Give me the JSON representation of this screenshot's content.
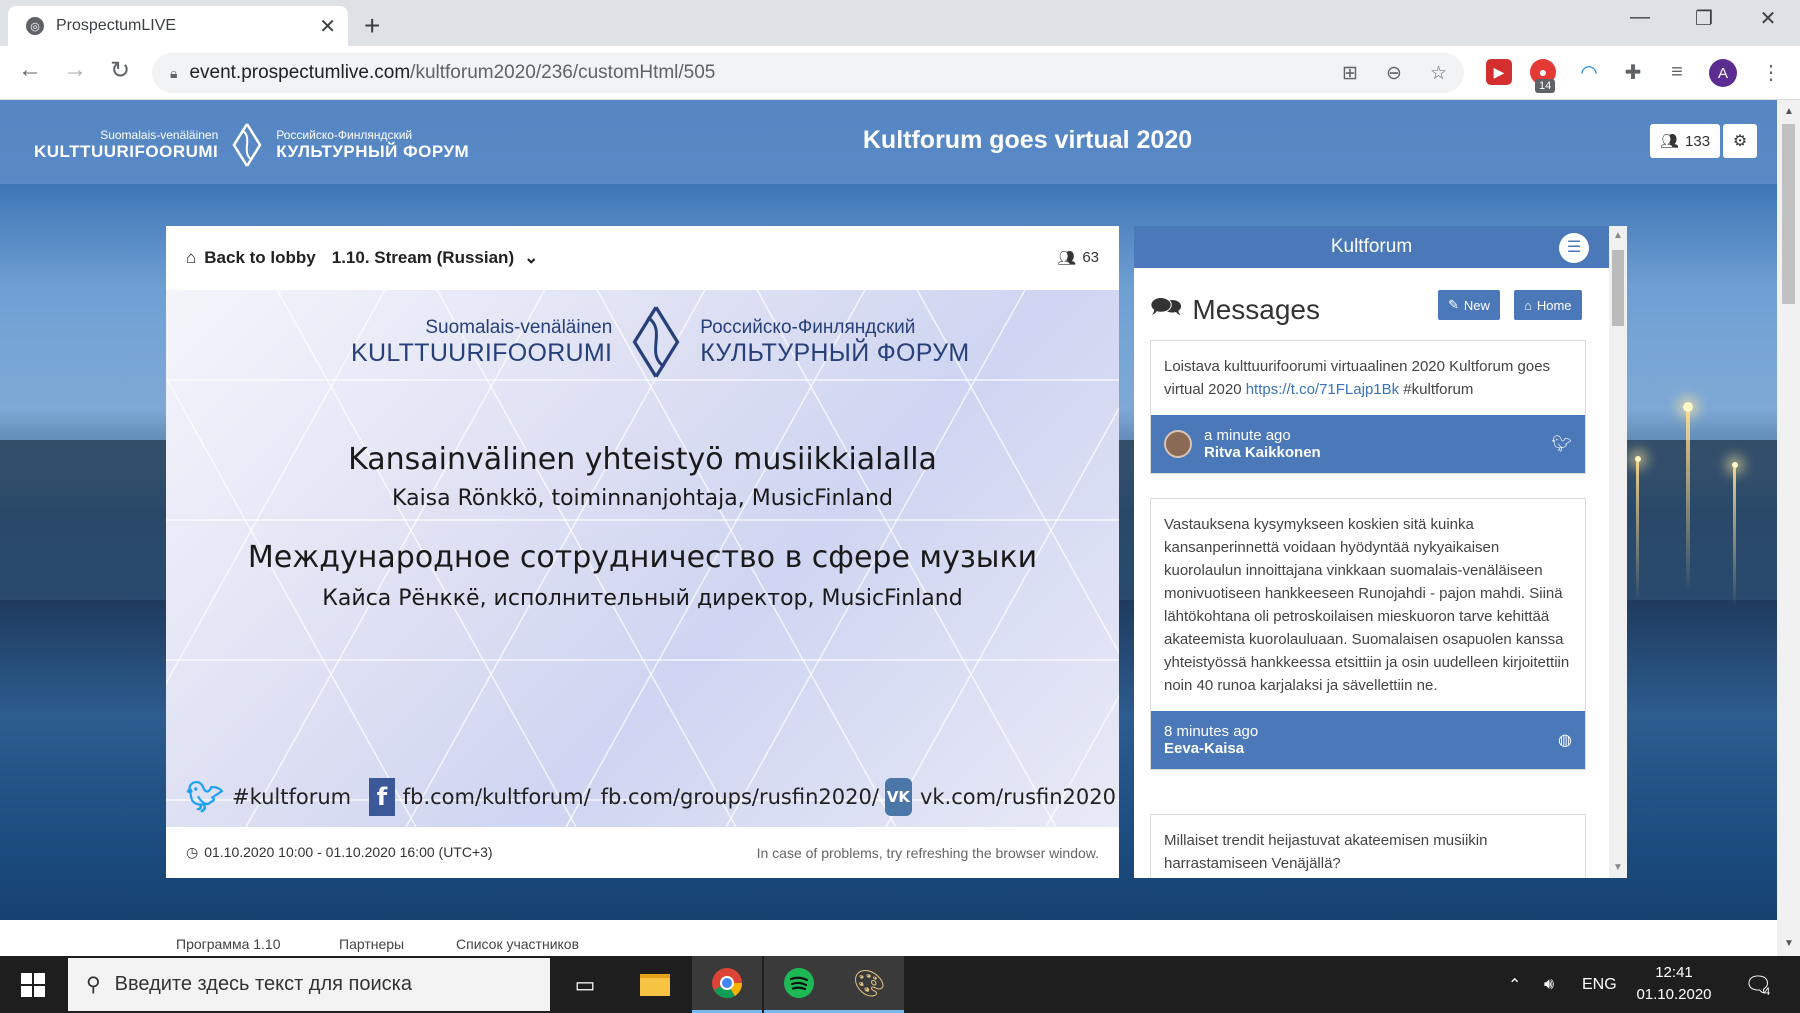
{
  "browser": {
    "tab_title": "ProspectumLIVE",
    "url_domain": "event.prospectumlive.com",
    "url_path": "/kultforum2020/236/customHtml/505",
    "ext_badge": "14",
    "profile_initial": "A"
  },
  "header": {
    "logo_fi_small": "Suomalais-venäläinen",
    "logo_fi_big": "KULTTUURIFOORUMI",
    "logo_ru_small": "Российско-Финляндский",
    "logo_ru_big": "КУЛЬТУРНЫЙ ФОРУМ",
    "event_title": "Kultforum goes virtual 2020",
    "participants": "133"
  },
  "stream": {
    "back_label": "Back to lobby",
    "selected_stream": "1.10. Stream (Russian)",
    "viewers": "63",
    "time_range": "01.10.2020 10:00 - 01.10.2020 16:00 (UTC+3)",
    "hint": "In case of problems, try refreshing the browser window."
  },
  "slide": {
    "logo_fi_small": "Suomalais-venäläinen",
    "logo_fi_big": "KULTTUURIFOORUMI",
    "logo_ru_small": "Российско-Финляндский",
    "logo_ru_big": "КУЛЬТУРНЫЙ ФОРУМ",
    "title_fi": "Kansainvälinen yhteistyö musiikkialalla",
    "speaker_fi": "Kaisa Rönkkö, toiminnanjohtaja, MusicFinland",
    "title_ru": "Международное сотрудничество в сфере музыки",
    "speaker_ru": "Кайса Рёнккё, исполнительный директор, MusicFinland",
    "twitter": "#kultforum",
    "facebook1": "fb.com/kultforum/",
    "facebook2": "fb.com/groups/rusfin2020/",
    "vk": "vk.com/rusfin2020"
  },
  "chat": {
    "header": "Kultforum",
    "messages_title": "Messages",
    "new_label": "New",
    "home_label": "Home",
    "items": [
      {
        "text": "Loistava kulttuurifoorumi virtuaalinen 2020 Kultforum goes virtual 2020 ",
        "link": "https://t.co/71FLajp1Bk",
        "tail": " #kultforum",
        "time": "a minute ago",
        "author": "Ritva Kaikkonen",
        "icon": "twitter-icon"
      },
      {
        "text": "Vastauksena kysymykseen koskien sitä kuinka kansanperinnettä voidaan hyödyntää nykyaikaisen kuorolaulun innoittajana vinkkaan suomalais-venäläiseen monivuotiseen hankkeeseen Runojahdi - pajon mahdi. Siinä lähtökohtana oli petroskoilaisen mieskuoron tarve kehittää akateemista kuorolauluaan. Suomalaisen osapuolen kanssa yhteistyössä hankkeessa etsittiin ja osin uudelleen kirjoitettiin noin 40 runoa karjalaksi ja sävellettiin ne.",
        "time": "8 minutes ago",
        "author": "Eeva-Kaisa",
        "icon": "globe-icon"
      },
      {
        "text": "Millaiset trendit heijastuvat akateemisen musiikin harrastamiseen Venäjällä?"
      }
    ]
  },
  "subnav": [
    "Программа 1.10",
    "Партнеры",
    "Список участников"
  ],
  "taskbar": {
    "search_placeholder": "Введите здесь текст для поиска",
    "lang": "ENG",
    "time": "12:41",
    "date": "01.10.2020",
    "notifications": "4"
  },
  "colors": {
    "header_bar": "#5c8cc8",
    "accent": "#4a78b8",
    "link": "#3a73b8"
  }
}
